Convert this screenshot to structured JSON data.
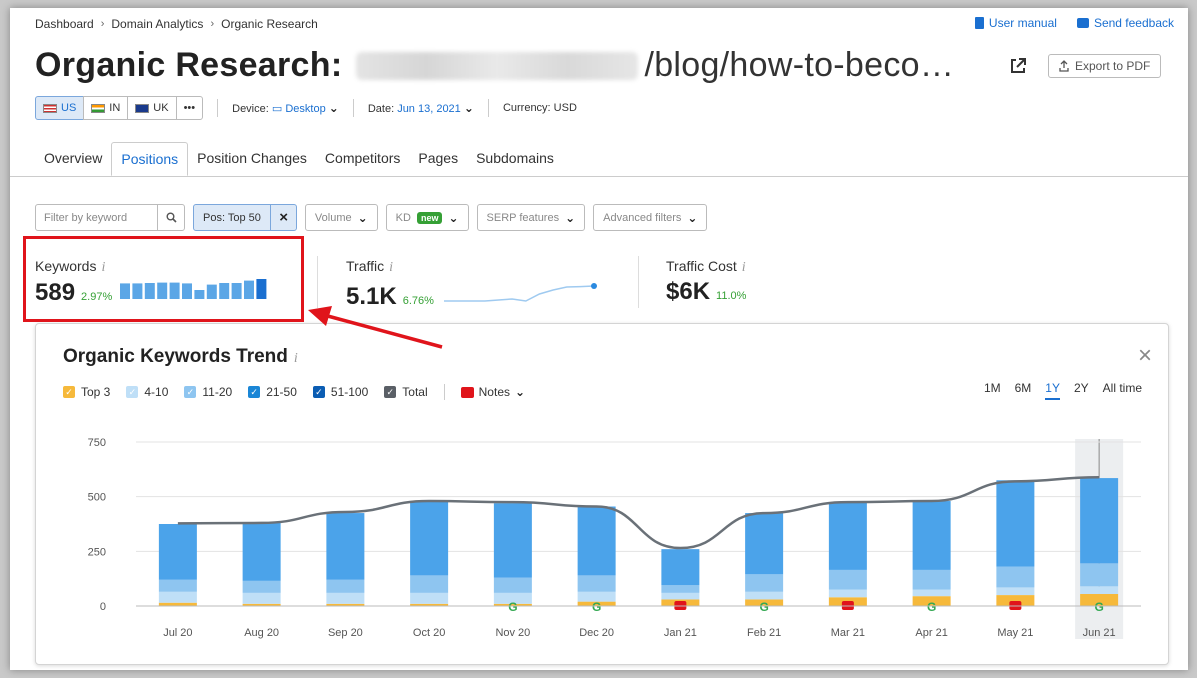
{
  "breadcrumb": [
    "Dashboard",
    "Domain Analytics",
    "Organic Research"
  ],
  "links": {
    "manual": "User manual",
    "feedback": "Send feedback"
  },
  "title": {
    "prefix": "Organic Research:",
    "url": "/blog/how-to-beco…"
  },
  "export_label": "Export to PDF",
  "databases": [
    "US",
    "IN",
    "UK",
    "•••"
  ],
  "device": {
    "label": "Device:",
    "value": "Desktop"
  },
  "date": {
    "label": "Date:",
    "value": "Jun 13, 2021"
  },
  "currency": "Currency: USD",
  "tabs": [
    "Overview",
    "Positions",
    "Position Changes",
    "Competitors",
    "Pages",
    "Subdomains"
  ],
  "filters": {
    "keyword_placeholder": "Filter by keyword",
    "pos": "Pos: Top 50",
    "volume": "Volume",
    "kd": "KD",
    "kd_badge": "new",
    "serp": "SERP features",
    "advanced": "Advanced filters"
  },
  "metrics": {
    "keywords": {
      "label": "Keywords",
      "value": "589",
      "change": "2.97%"
    },
    "traffic": {
      "label": "Traffic",
      "value": "5.1K",
      "change": "6.76%"
    },
    "cost": {
      "label": "Traffic Cost",
      "value": "$6K",
      "change": "11.0%"
    }
  },
  "sparkline_keywords": [
    0.78,
    0.78,
    0.8,
    0.82,
    0.82,
    0.78,
    0.45,
    0.72,
    0.8,
    0.8,
    0.92,
    1.0
  ],
  "sparkline_traffic": [
    0.0,
    0.0,
    0.0,
    0.0,
    0.05,
    0.1,
    0.0,
    0.35,
    0.55,
    0.7,
    0.72,
    0.75
  ],
  "trend": {
    "title": "Organic Keywords Trend",
    "legend": [
      {
        "label": "Top 3",
        "color": "#f6b93b"
      },
      {
        "label": "4-10",
        "color": "#bfdff7"
      },
      {
        "label": "11-20",
        "color": "#8ec5f0"
      },
      {
        "label": "21-50",
        "color": "#1a86d6"
      },
      {
        "label": "51-100",
        "color": "#0b5db3"
      },
      {
        "label": "Total",
        "color": "#5a5f66"
      }
    ],
    "notes_label": "Notes",
    "ranges": [
      "1M",
      "6M",
      "1Y",
      "2Y",
      "All time"
    ],
    "active_range": "1Y"
  },
  "chart_data": {
    "type": "bar",
    "categories": [
      "Jul 20",
      "Aug 20",
      "Sep 20",
      "Oct 20",
      "Nov 20",
      "Dec 20",
      "Jan 21",
      "Feb 21",
      "Mar 21",
      "Apr 21",
      "May 21",
      "Jun 21"
    ],
    "series": [
      {
        "name": "Top 3",
        "values": [
          15,
          10,
          10,
          10,
          10,
          20,
          30,
          30,
          40,
          45,
          50,
          55
        ]
      },
      {
        "name": "4-10",
        "values": [
          50,
          50,
          50,
          50,
          50,
          45,
          30,
          35,
          35,
          30,
          35,
          35
        ]
      },
      {
        "name": "11-20",
        "values": [
          55,
          55,
          60,
          80,
          70,
          75,
          35,
          80,
          90,
          90,
          95,
          105
        ]
      },
      {
        "name": "21-50",
        "values": [
          255,
          265,
          305,
          340,
          340,
          315,
          165,
          280,
          310,
          315,
          395,
          390
        ]
      },
      {
        "name": "Total",
        "values": [
          378,
          380,
          430,
          480,
          475,
          455,
          265,
          425,
          475,
          480,
          570,
          589
        ]
      }
    ],
    "yticks": [
      0,
      250,
      500,
      750
    ],
    "ylim": [
      0,
      750
    ],
    "highlight": "Jun 21",
    "markers": [
      "",
      "",
      "",
      "",
      "google",
      "google",
      "note",
      "google",
      "note",
      "google",
      "note",
      "google"
    ]
  }
}
